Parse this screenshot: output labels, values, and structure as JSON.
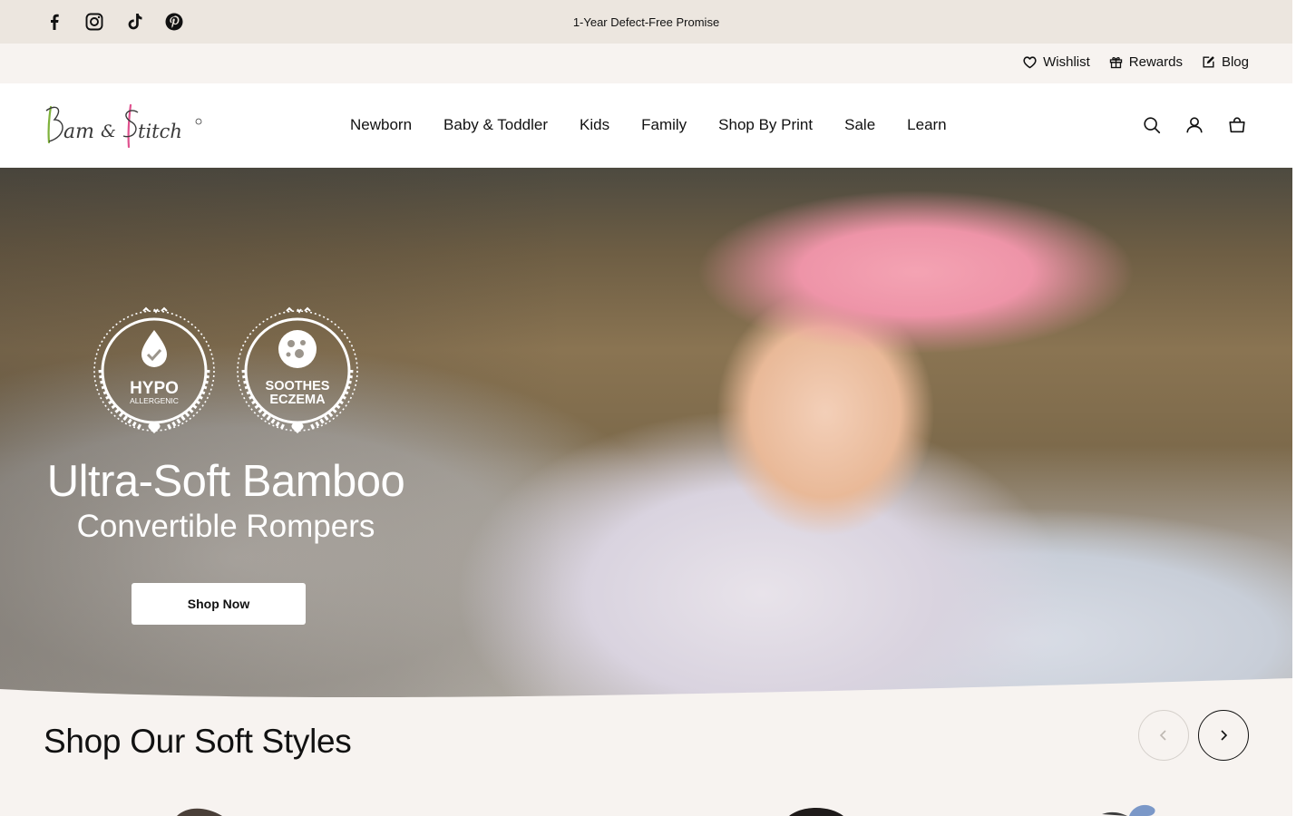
{
  "announcement": {
    "text": "1-Year Defect-Free Promise",
    "social_icons": [
      "facebook-icon",
      "instagram-icon",
      "tiktok-icon",
      "pinterest-icon"
    ]
  },
  "utility": {
    "wishlist": "Wishlist",
    "rewards": "Rewards",
    "blog": "Blog"
  },
  "header": {
    "logo_text": "Bam & Stitch",
    "nav": [
      "Newborn",
      "Baby & Toddler",
      "Kids",
      "Family",
      "Shop By Print",
      "Sale",
      "Learn"
    ],
    "icons": [
      "search-icon",
      "account-icon",
      "cart-icon"
    ]
  },
  "hero": {
    "badge_1_line1": "HYPO",
    "badge_1_line2": "ALLERGENIC",
    "badge_2_line1": "SOOTHES",
    "badge_2_line2": "ECZEMA",
    "title": "Ultra-Soft Bamboo",
    "subtitle": "Convertible Rompers",
    "cta": "Shop Now"
  },
  "section": {
    "title": "Shop Our Soft Styles"
  },
  "colors": {
    "announcement_bg": "#ece6df",
    "page_bg": "#f7f3f0",
    "header_bg": "#ffffff",
    "logo_green": "#7fb23b",
    "logo_pink": "#e0528f",
    "text": "#111111"
  }
}
